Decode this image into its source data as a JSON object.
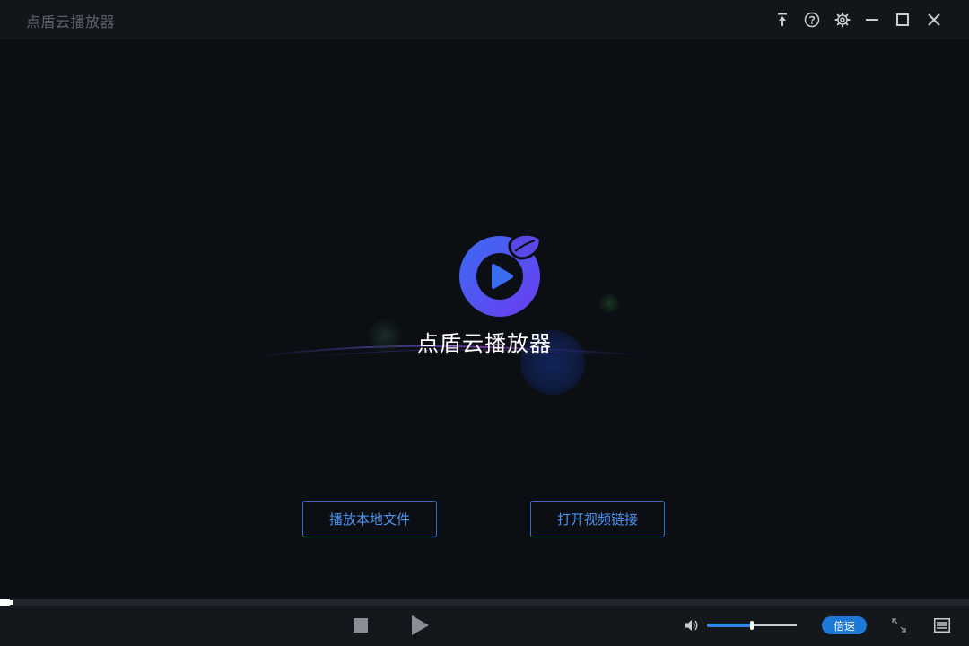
{
  "window": {
    "title": "点盾云播放器"
  },
  "titlebar": {
    "icons": [
      "pin-icon",
      "help-icon",
      "settings-icon",
      "minimize-icon",
      "maximize-icon",
      "close-icon"
    ]
  },
  "stage": {
    "logo_text": "点盾云播放器",
    "buttons": {
      "play_local": "播放本地文件",
      "open_link": "打开视频链接"
    }
  },
  "controls": {
    "progress": 0.01,
    "volume": 0.5,
    "speed_label": "倍速",
    "icons": [
      "stop-icon",
      "play-icon",
      "volume-icon",
      "fullscreen-icon",
      "playlist-icon"
    ]
  },
  "colors": {
    "background": "#0b0e13",
    "titlebar": "#12161b",
    "accent": "#2f86e8",
    "button_border": "#2d6fc7",
    "button_text": "#4b93f0",
    "speed_badge": "#1e78d6",
    "logo_gradient_start": "#3a6cf2",
    "logo_gradient_end": "#6b3cf0"
  }
}
